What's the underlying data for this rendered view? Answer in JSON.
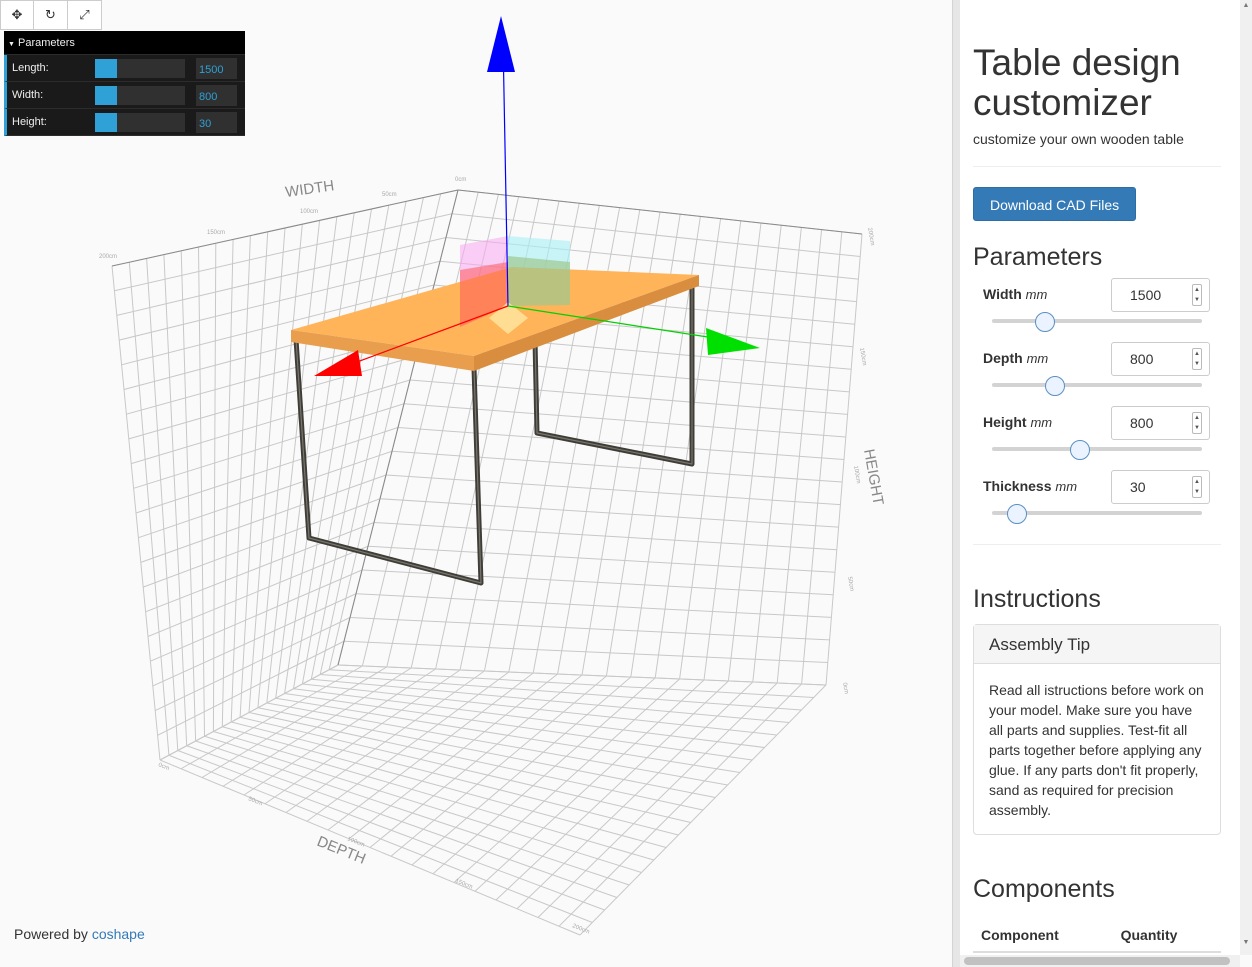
{
  "viewer": {
    "toolbar": [
      {
        "name": "pan-button",
        "icon": "move-icon",
        "glyph": "✥"
      },
      {
        "name": "rotate-button",
        "icon": "rotate-icon",
        "glyph": "↻"
      },
      {
        "name": "fullscreen-button",
        "icon": "expand-icon",
        "glyph": "⤢"
      }
    ],
    "gui": {
      "title": "Parameters",
      "rows": [
        {
          "label": "Length:",
          "value": "1500",
          "fill": 0.24
        },
        {
          "label": "Width:",
          "value": "800",
          "fill": 0.24
        },
        {
          "label": "Height:",
          "value": "30",
          "fill": 0.24
        }
      ]
    },
    "axes": {
      "width_label": "WIDTH",
      "height_label": "HEIGHT",
      "depth_label": "DEPTH"
    },
    "powered_by": {
      "prefix": "Powered by",
      "link": "coshape"
    },
    "colors": {
      "accent": "#2fa1d6",
      "table_top": "#ffb45a",
      "frame": "#4a4a44",
      "x_axis": "#ff0000",
      "y_axis": "#00d000",
      "z_axis": "#0000ff"
    }
  },
  "panel": {
    "title": "Table design customizer",
    "subtitle": "customize your own wooden table",
    "download_button": "Download CAD Files",
    "parameters_heading": "Parameters",
    "unit": "mm",
    "parameters": [
      {
        "label": "Width",
        "value": "1500",
        "slider": 0.25
      },
      {
        "label": "Depth",
        "value": "800",
        "slider": 0.3
      },
      {
        "label": "Height",
        "value": "800",
        "slider": 0.42
      },
      {
        "label": "Thickness",
        "value": "30",
        "slider": 0.12
      }
    ],
    "instructions_heading": "Instructions",
    "tip_title": "Assembly Tip",
    "tip_body": "Read all istructions before work on your model. Make sure you have all parts and supplies. Test-fit all parts together before applying any glue. If any parts don't fit properly, sand as required for precision assembly.",
    "components_heading": "Components",
    "components_columns": [
      "Component",
      "Quantity"
    ]
  }
}
